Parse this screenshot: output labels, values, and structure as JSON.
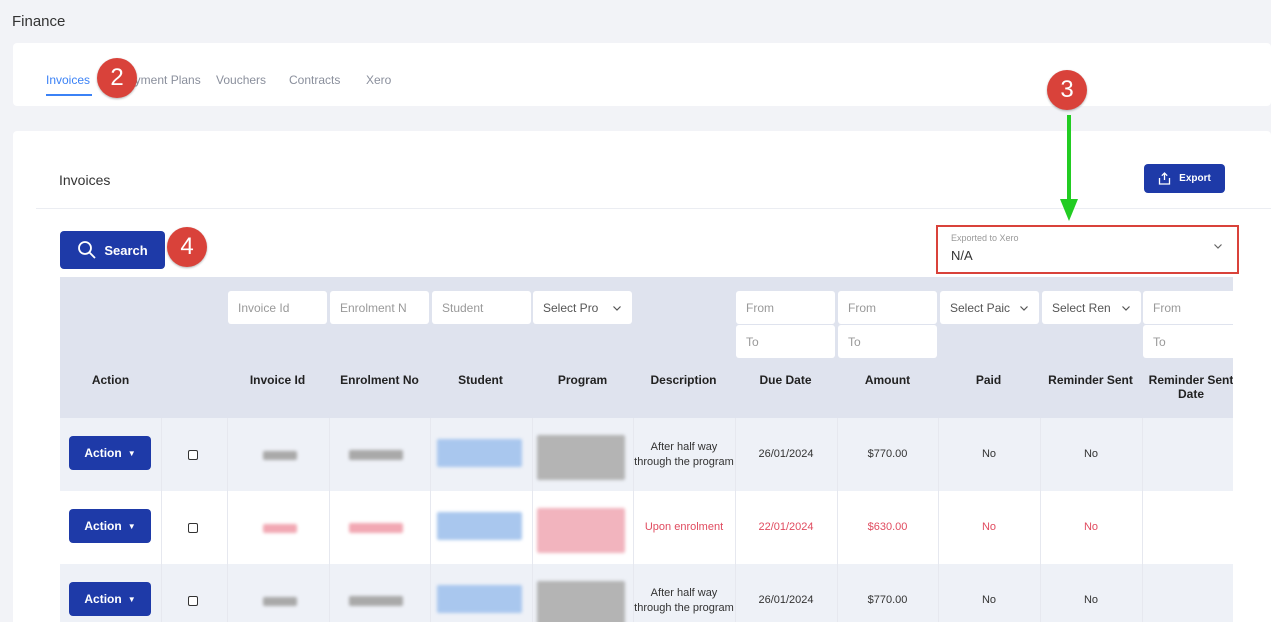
{
  "page": {
    "title": "Finance"
  },
  "tabs": [
    {
      "label": "Invoices",
      "active": true
    },
    {
      "label": "Payment Plans",
      "active": false
    },
    {
      "label": "Vouchers",
      "active": false
    },
    {
      "label": "Contracts",
      "active": false
    },
    {
      "label": "Xero",
      "active": false
    }
  ],
  "section": {
    "title": "Invoices",
    "export_label": "Export",
    "search_label": "Search"
  },
  "xero_filter": {
    "label": "Exported to Xero",
    "value": "N/A"
  },
  "annotations": {
    "badge_2": "2",
    "badge_3": "3",
    "badge_4": "4"
  },
  "filters": {
    "invoice_id": "Invoice Id",
    "enrolment_no": "Enrolment N",
    "student": "Student",
    "program": "Select Pro",
    "due_from": "From",
    "due_to": "To",
    "amount_from": "From",
    "amount_to": "To",
    "paid": "Select Paic",
    "reminder": "Select Ren",
    "reminder_from": "From",
    "reminder_to": "To"
  },
  "columns": {
    "action": "Action",
    "invoice_id": "Invoice Id",
    "enrolment_no": "Enrolment No",
    "student": "Student",
    "program": "Program",
    "description": "Description",
    "due_date": "Due Date",
    "amount": "Amount",
    "paid": "Paid",
    "reminder_sent": "Reminder Sent",
    "reminder_sent_date": "Reminder Sent Date"
  },
  "rows": [
    {
      "action": "Action",
      "description": "After half way through the program",
      "due_date": "26/01/2024",
      "amount": "$770.00",
      "paid": "No",
      "reminder_sent": "No",
      "overdue": false
    },
    {
      "action": "Action",
      "description": "Upon enrolment",
      "due_date": "22/01/2024",
      "amount": "$630.00",
      "paid": "No",
      "reminder_sent": "No",
      "overdue": true
    },
    {
      "action": "Action",
      "description": "After half way through the program",
      "due_date": "26/01/2024",
      "amount": "$770.00",
      "paid": "No",
      "reminder_sent": "No",
      "overdue": false
    }
  ],
  "colors": {
    "primary": "#1e3aa8",
    "accent": "#3b82f6",
    "overdue": "#e04b5f",
    "annotation": "#d9423a",
    "arrow": "#22cc22"
  }
}
